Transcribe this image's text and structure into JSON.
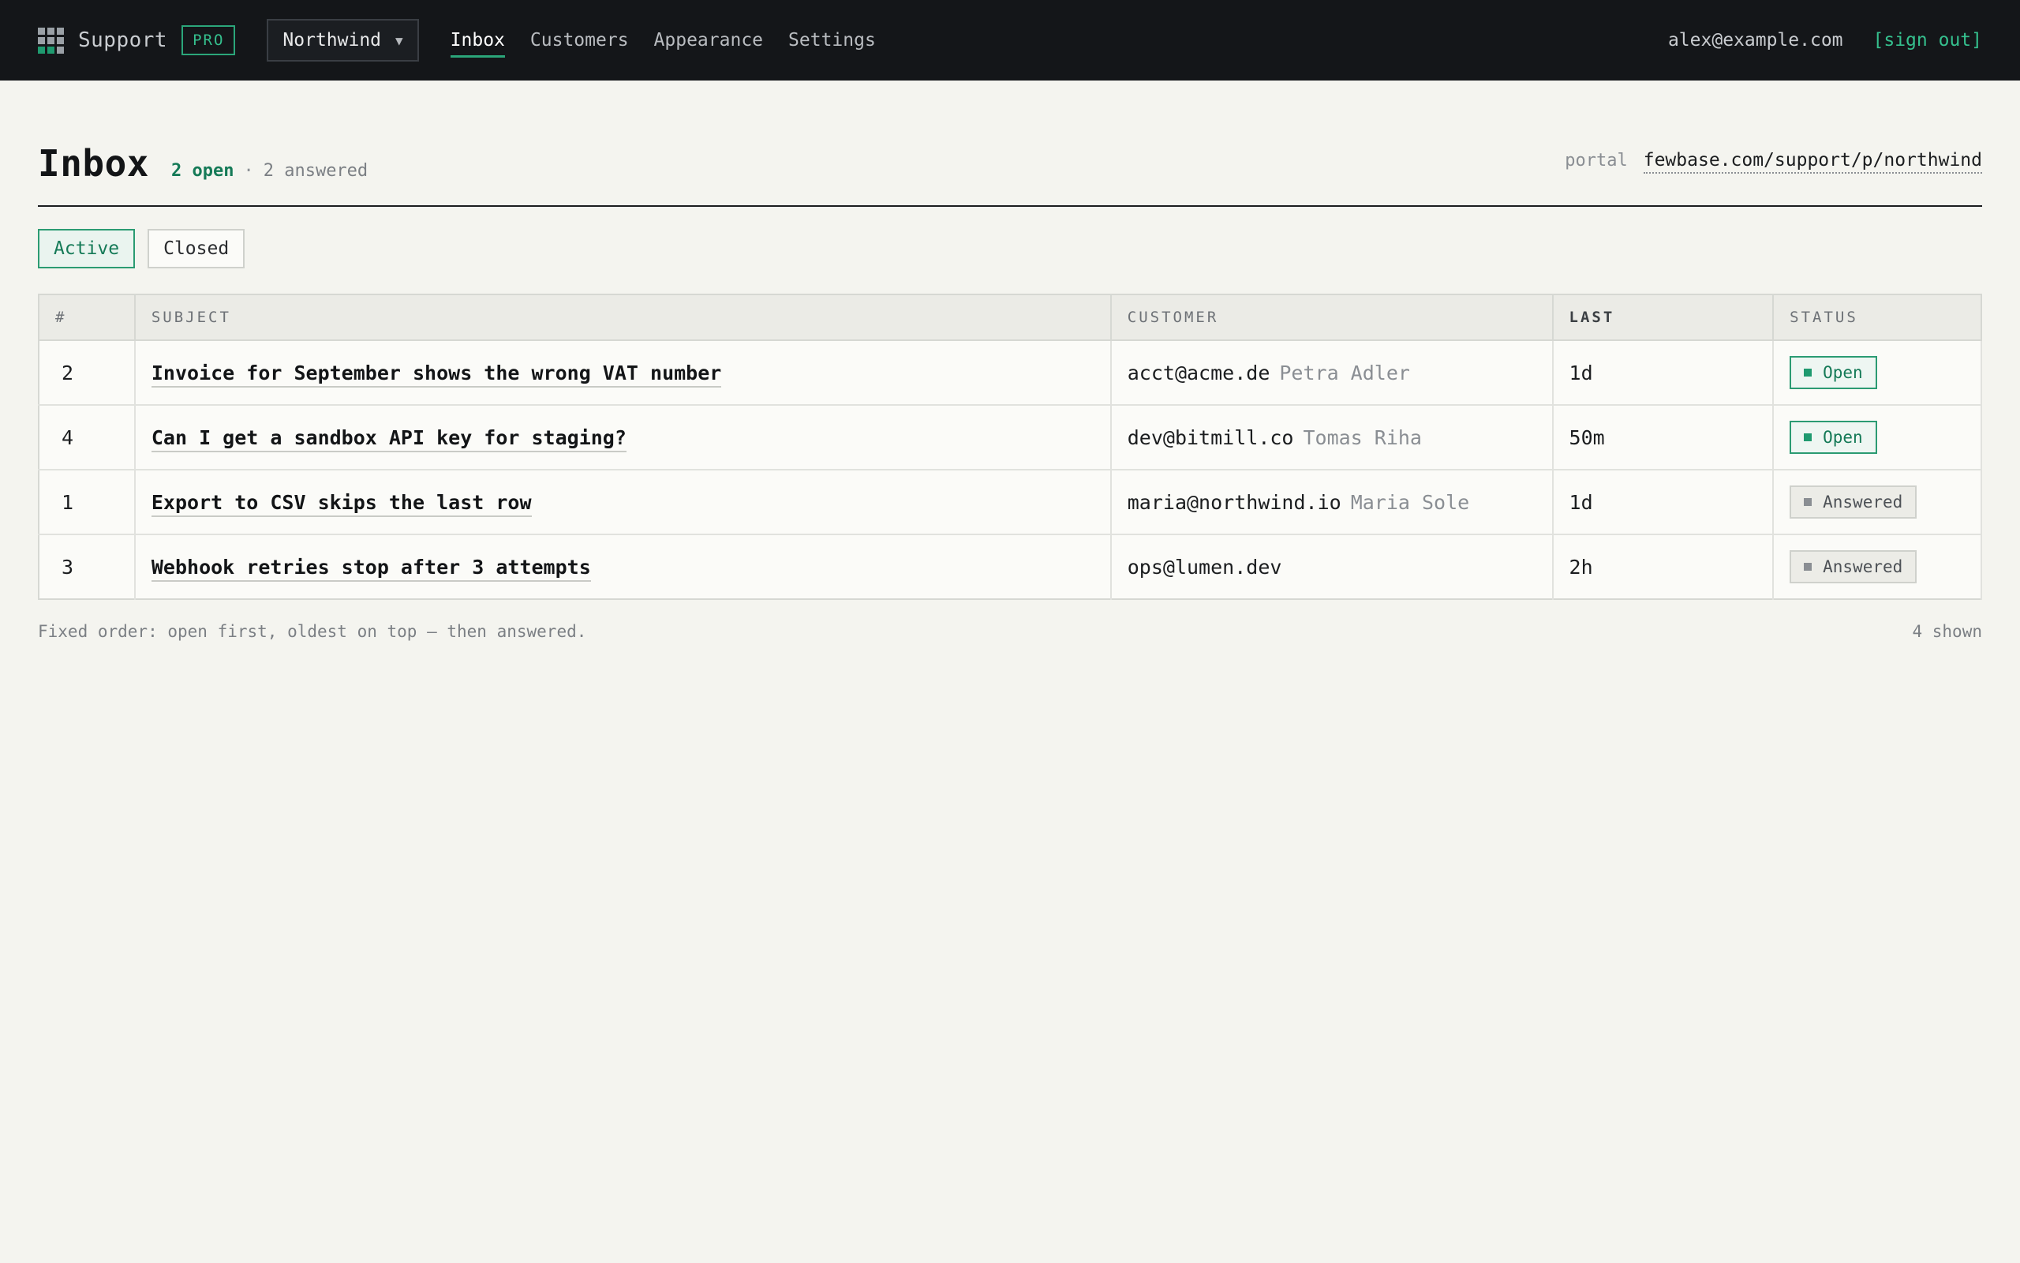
{
  "topbar": {
    "brand": "Support",
    "badge": "PRO",
    "workspace": "Northwind",
    "nav": [
      {
        "label": "Inbox",
        "active": true
      },
      {
        "label": "Customers",
        "active": false
      },
      {
        "label": "Appearance",
        "active": false
      },
      {
        "label": "Settings",
        "active": false
      }
    ],
    "user_email": "alex@example.com",
    "signout_label": "[sign out]"
  },
  "header": {
    "title": "Inbox",
    "open_count": "2 open",
    "separator": "·",
    "answered_count": "2 answered",
    "portal_label": "portal",
    "portal_url": "fewbase.com/support/p/northwind"
  },
  "filters": [
    {
      "label": "Active",
      "active": true
    },
    {
      "label": "Closed",
      "active": false
    }
  ],
  "table": {
    "columns": [
      "#",
      "SUBJECT",
      "CUSTOMER",
      "LAST",
      "STATUS"
    ],
    "rows": [
      {
        "num": "2",
        "subject": "Invoice for September shows the wrong VAT number",
        "email": "acct@acme.de",
        "name": "Petra Adler",
        "last": "1d",
        "status": "Open"
      },
      {
        "num": "4",
        "subject": "Can I get a sandbox API key for staging?",
        "email": "dev@bitmill.co",
        "name": "Tomas Riha",
        "last": "50m",
        "status": "Open"
      },
      {
        "num": "1",
        "subject": "Export to CSV skips the last row",
        "email": "maria@northwind.io",
        "name": "Maria Sole",
        "last": "1d",
        "status": "Answered"
      },
      {
        "num": "3",
        "subject": "Webhook retries stop after 3 attempts",
        "email": "ops@lumen.dev",
        "name": "",
        "last": "2h",
        "status": "Answered"
      }
    ]
  },
  "footer": {
    "note": "Fixed order: open first, oldest on top — then answered.",
    "shown": "4 shown"
  },
  "colors": {
    "accent": "#2ba67a",
    "topbar": "#141619",
    "background": "#f4f4ef"
  },
  "icons": {
    "logo": "grid-logo-icon",
    "workspace_dropdown": "chevron-down-icon",
    "status_marker": "square-icon"
  }
}
